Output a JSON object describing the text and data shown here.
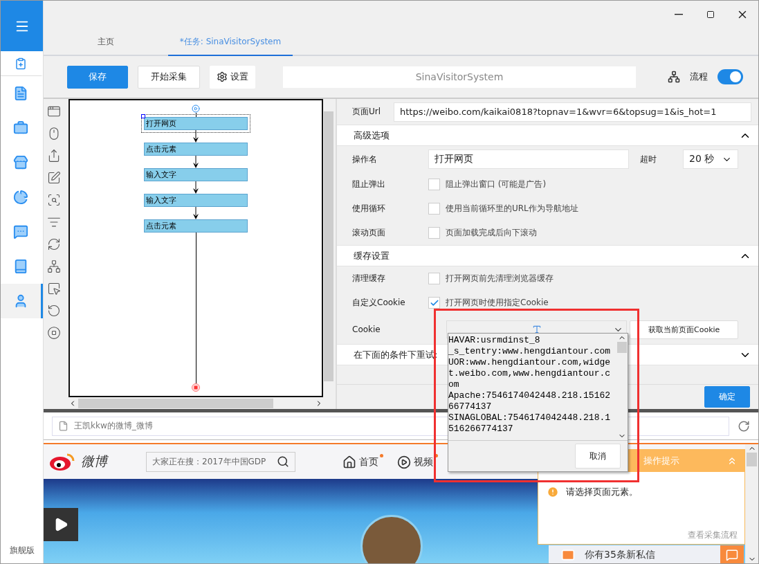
{
  "sidebar": {
    "items": [
      {
        "selected": false
      },
      {
        "selected": false
      },
      {
        "selected": false
      },
      {
        "selected": false
      },
      {
        "selected": false
      },
      {
        "selected": false
      },
      {
        "selected": false
      },
      {
        "selected": true
      }
    ],
    "edition": "旗舰版"
  },
  "tabs": [
    {
      "label": "主页",
      "selected": false
    },
    {
      "label": "*任务: SinaVisitorSystem",
      "selected": true
    }
  ],
  "toolbar": {
    "save": "保存",
    "start": "开始采集",
    "settings": "设置",
    "task_name": "SinaVisitorSystem",
    "flow_toggle": {
      "label": "流程",
      "on": true
    }
  },
  "flow": {
    "steps": [
      {
        "label": "打开网页",
        "selected": true
      },
      {
        "label": "点击元素",
        "selected": false
      },
      {
        "label": "输入文字",
        "selected": false
      },
      {
        "label": "输入文字",
        "selected": false
      },
      {
        "label": "点击元素",
        "selected": false
      }
    ]
  },
  "properties": {
    "url": {
      "label": "页面Url",
      "value": "https://weibo.com/kaikai0818?topnav=1&wvr=6&topsug=1&is_hot=1"
    },
    "advanced": {
      "title": "高级选项",
      "expanded": true
    },
    "operation_name": {
      "label": "操作名",
      "value": "打开网页"
    },
    "timeout": {
      "label": "超时",
      "value": "20 秒"
    },
    "advanced_options": [
      {
        "label": "阻止弹出",
        "text": "阻止弹出窗口 (可能是广告)",
        "checked": false
      },
      {
        "label": "使用循环",
        "text": "使用当前循环里的URL作为导航地址",
        "checked": false
      },
      {
        "label": "滚动页面",
        "text": "页面加载完成后向下滚动",
        "checked": false
      }
    ],
    "cache": {
      "title": "缓存设置",
      "expanded": true
    },
    "cache_options": [
      {
        "label": "清理缓存",
        "text": "打开网页前先清理浏览器缓存",
        "checked": false
      },
      {
        "label": "自定义Cookie",
        "text": "打开网页时使用指定Cookie",
        "checked": true
      }
    ],
    "cookie": {
      "label": "Cookie",
      "fetch_button": "获取当前页面Cookie",
      "lines": [
        "HAVAR:usrmdinst_8",
        "_s_tentry:www.hengdiantour.com",
        "UOR:www.hengdiantour.com,widge",
        "t.weibo.com,www.hengdiantour.c",
        "om",
        "Apache:7546174042448.218.15162",
        "66774137",
        "SINAGLOBAL:7546174042448.218.1",
        "516266774137"
      ],
      "cancel_button": "取消"
    },
    "retry": {
      "title": "在下面的条件下重试:",
      "expanded": false
    },
    "confirm_button": "确定"
  },
  "browser": {
    "page_title": "王凯kkw的微博_微博",
    "logo_text": "微博",
    "search_placeholder": "大家正在搜：2017年中国GDP",
    "nav": [
      {
        "label": "首页"
      },
      {
        "label": "视频"
      }
    ],
    "message": "你有35条新私信"
  },
  "hint_panel": {
    "title": "操作提示",
    "message": "请选择页面元素。",
    "link": "查看采集流程"
  }
}
